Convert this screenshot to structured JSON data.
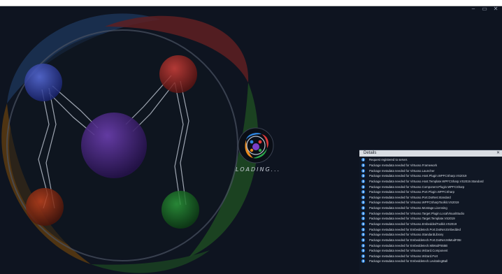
{
  "window": {
    "controls": {
      "minimize": "–",
      "maximize": "▭",
      "close": "✕"
    }
  },
  "loading": {
    "label": "LOADING...",
    "logo_icon": "m-logo-icon"
  },
  "details": {
    "title": "Details",
    "close_label": "✕",
    "items": [
      "Request registered to server.",
      "Package metadata needed for Virtuoso.Framework",
      "Package metadata needed for Virtuoso.Launcher",
      "Package metadata needed for Virtuoso.Host.Plugin.WPFCSharp.VS2019",
      "Package metadata needed for Virtuoso.Host.Template.WPFCSharp.VS2019.Standard",
      "Package metadata needed for Virtuoso.Component.Plugin.WPFCSharp",
      "Package metadata needed for Virtuoso.Port.Plugin.WPFCSharp",
      "Package metadata needed for Virtuoso.Port.DotNet.Standard",
      "Package metadata needed for Virtuoso.WPFCSharpToolkit.VS2019",
      "Package metadata needed for Virtuoso.Montage.Licensing",
      "Package metadata needed for Virtuoso.Target.Plugin.LocalVisualStudio",
      "Package metadata needed for Virtuoso.Target.Template.VS2019",
      "Package metadata needed for Virtuoso.EmbeddedToolkit.VS2019",
      "Package metadata needed for Embeddetech.Port.DotNet.Embedded",
      "Package metadata needed for Virtuoso.StandardLibrary",
      "Package metadata needed for Embeddetech.Port.DotNet.MiModF05I",
      "Package metadata needed for Embeddetech.MiModF555B",
      "Package metadata needed for Virtuoso.Wizard.Component",
      "Package metadata needed for Virtuoso.Wizard.Port",
      "Package metadata needed for Embeddetech.LevitatingBall"
    ]
  },
  "colors": {
    "background": "#0e1420",
    "accent": "#2f86e0"
  }
}
